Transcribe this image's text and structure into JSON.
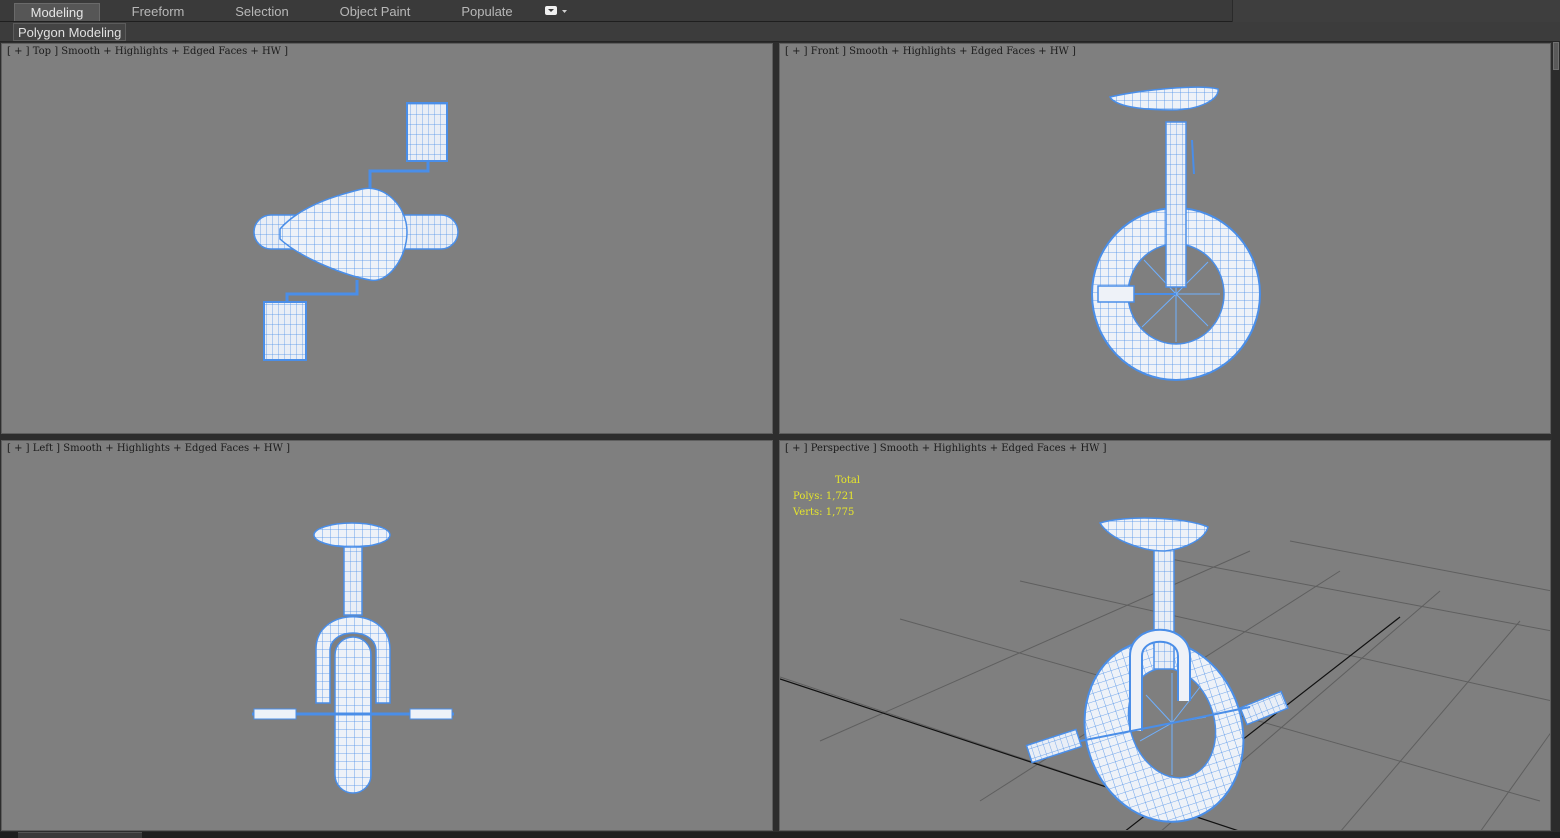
{
  "ribbon": {
    "tabs": [
      {
        "label": "Modeling",
        "active": true
      },
      {
        "label": "Freeform",
        "active": false
      },
      {
        "label": "Selection",
        "active": false
      },
      {
        "label": "Object Paint",
        "active": false
      },
      {
        "label": "Populate",
        "active": false
      }
    ],
    "toggle_icon": "panel-dropdown-icon"
  },
  "subbar": {
    "label": "Polygon Modeling"
  },
  "viewports": {
    "top": {
      "label": "[ + ] Top ] Smooth + Highlights + Edged Faces + HW ]"
    },
    "front": {
      "label": "[ + ] Front ] Smooth + Highlights + Edged Faces + HW ]"
    },
    "left": {
      "label": "[ + ] Left ] Smooth + Highlights + Edged Faces + HW ]"
    },
    "perspective": {
      "label": "[ + ] Perspective ] Smooth + Highlights + Edged Faces + HW ]"
    }
  },
  "stats": {
    "total_label": "Total",
    "polys_label": "Polys:",
    "polys_value": "1,721",
    "verts_label": "Verts:",
    "verts_value": "1,775"
  },
  "colors": {
    "viewport_bg": "#7f7f7f",
    "wire": "#4a8ee8",
    "surface": "#eef2f8",
    "stats_text": "#e6e62b",
    "active_tab": "#565656"
  }
}
